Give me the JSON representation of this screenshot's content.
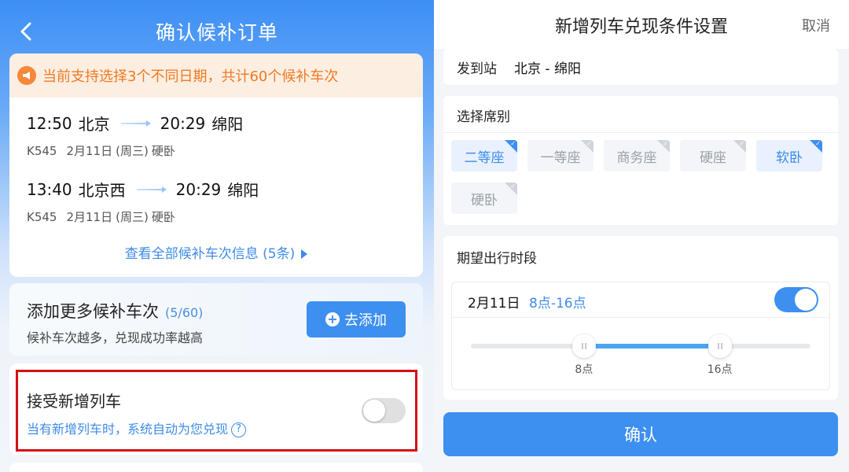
{
  "left": {
    "title": "确认候补订单",
    "notice": "当前支持选择3个不同日期，共计60个候补车次",
    "trains": [
      {
        "dep_time": "12:50",
        "dep_station": "北京",
        "arr_time": "20:29",
        "arr_station": "绵阳",
        "train_no": "K545",
        "date": "2月11日",
        "weekday": "(周三)",
        "seat": "硬卧"
      },
      {
        "dep_time": "13:40",
        "dep_station": "北京西",
        "arr_time": "20:29",
        "arr_station": "绵阳",
        "train_no": "K545",
        "date": "2月11日",
        "weekday": "(周三)",
        "seat": "硬卧"
      }
    ],
    "view_all": "查看全部候补车次信息 (5条)",
    "add_more": {
      "title": "添加更多候补车次",
      "count": "(5/60)",
      "subtitle": "候补车次越多，兑现成功率越高",
      "button": "去添加"
    },
    "accept_new": {
      "title": "接受新增列车",
      "subtitle": "当有新增列车时，系统自动为您兑现",
      "help": "?",
      "enabled": false
    }
  },
  "right": {
    "title": "新增列车兑现条件设置",
    "cancel": "取消",
    "route": {
      "label": "发到站",
      "value": "北京 - 绵阳"
    },
    "seat_section": {
      "label": "选择席别",
      "seats": [
        {
          "label": "二等座",
          "selected": true
        },
        {
          "label": "一等座",
          "selected": false
        },
        {
          "label": "商务座",
          "selected": false
        },
        {
          "label": "硬座",
          "selected": false
        },
        {
          "label": "软卧",
          "selected": true
        },
        {
          "label": "硬卧",
          "selected": false
        }
      ]
    },
    "time_section": {
      "label": "期望出行时段",
      "date": "2月11日",
      "range": "8点-16点",
      "enabled": true,
      "slider_start_label": "8点",
      "slider_end_label": "16点",
      "slider_start_fraction": 0.333,
      "slider_end_fraction": 0.733
    },
    "confirm": "确认"
  },
  "colors": {
    "accent": "#3d8ff0",
    "notice_text": "#f07a22",
    "highlight_border": "#d40f14"
  },
  "icons": {
    "back": "chevron-left-icon",
    "notice": "megaphone-icon",
    "add": "plus-circle-icon",
    "help": "question-circle-icon"
  }
}
